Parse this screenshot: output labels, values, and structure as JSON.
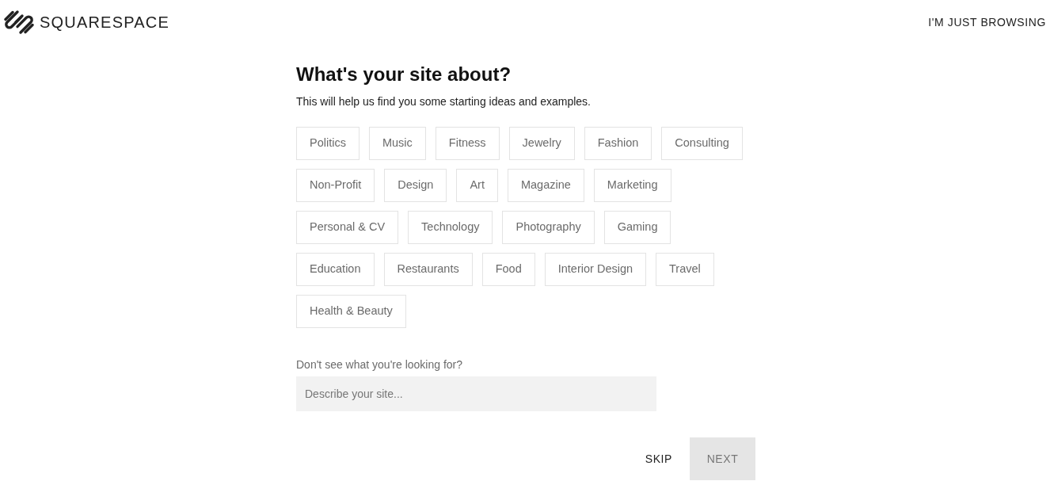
{
  "header": {
    "brand": "SQUARESPACE",
    "browse_link": "I'M JUST BROWSING"
  },
  "title": "What's your site about?",
  "subtitle": "This will help us find you some starting ideas and examples.",
  "topics": [
    {
      "label": "Politics",
      "selected": false
    },
    {
      "label": "Music",
      "selected": false
    },
    {
      "label": "Fitness",
      "selected": false
    },
    {
      "label": "Jewelry",
      "selected": false
    },
    {
      "label": "Fashion",
      "selected": false
    },
    {
      "label": "Consulting",
      "selected": false
    },
    {
      "label": "Non-Profit",
      "selected": false
    },
    {
      "label": "Design",
      "selected": false
    },
    {
      "label": "Art",
      "selected": false
    },
    {
      "label": "Magazine",
      "selected": false
    },
    {
      "label": "Marketing",
      "selected": false
    },
    {
      "label": "Personal & CV",
      "selected": false
    },
    {
      "label": "Technology",
      "selected": false
    },
    {
      "label": "Photography",
      "selected": false
    },
    {
      "label": "Gaming",
      "selected": false
    },
    {
      "label": "Education",
      "selected": false
    },
    {
      "label": "Restaurants",
      "selected": false
    },
    {
      "label": "Food",
      "selected": false
    },
    {
      "label": "Interior Design",
      "selected": false
    },
    {
      "label": "Travel",
      "selected": false
    },
    {
      "label": "Health & Beauty",
      "selected": false
    }
  ],
  "describe": {
    "label": "Don't see what you're looking for?",
    "placeholder": "Describe your site..."
  },
  "actions": {
    "skip": {
      "label": "SKIP"
    },
    "next": {
      "label": "NEXT",
      "disabled": true
    }
  }
}
